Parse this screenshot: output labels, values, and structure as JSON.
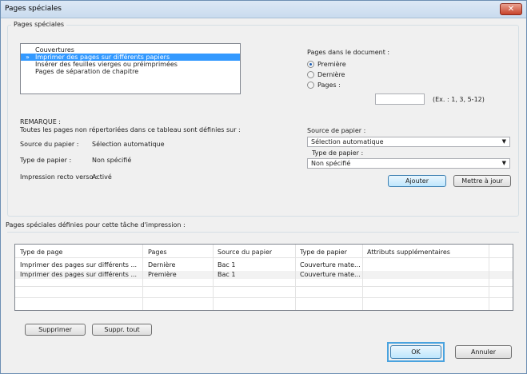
{
  "window": {
    "title": "Pages spéciales",
    "close_glyph": "✕"
  },
  "group_title": "Pages spéciales",
  "types_list": {
    "items": [
      {
        "label": "Couvertures"
      },
      {
        "label": "Imprimer des pages sur différents papiers",
        "selected": true
      },
      {
        "label": "Insérer des feuilles vierges ou préimprimées"
      },
      {
        "label": "Pages de séparation de chapitre"
      }
    ],
    "selected_marker": "»"
  },
  "pages_in_document": {
    "label": "Pages dans le document :",
    "options": [
      "Première",
      "Dernière",
      "Pages :"
    ],
    "selected": "Première",
    "pages_hint": "(Ex. : 1, 3, 5-12)"
  },
  "remark": {
    "title": "REMARQUE :",
    "text": "Toutes les pages non répertoriées dans ce tableau sont définies sur :",
    "source_label": "Source du papier :",
    "source_value": "Sélection automatique",
    "type_label": "Type de papier :",
    "type_value": "Non spécifié",
    "duplex_label": "Impression recto verso :",
    "duplex_value": "Activé"
  },
  "right_panel": {
    "source_label": "Source de papier :",
    "source_value": "Sélection automatique",
    "type_label": "Type de papier :",
    "type_value": "Non spécifié",
    "add_button": "Ajouter",
    "update_button": "Mettre à jour",
    "dropdown_glyph": "▼"
  },
  "table_section_label": "Pages spéciales définies pour cette tâche d'impression :",
  "table": {
    "headers": [
      "Type de page",
      "Pages",
      "Source du papier",
      "Type de papier",
      "Attributs supplémentaires"
    ],
    "rows": [
      [
        "Imprimer des pages sur différents ...",
        "Dernière",
        "Bac 1",
        "Couverture mate...",
        ""
      ],
      [
        "Imprimer des pages sur différents ...",
        "Première",
        "Bac 1",
        "Couverture mate...",
        ""
      ]
    ]
  },
  "buttons": {
    "delete": "Supprimer",
    "delete_all": "Suppr. tout",
    "ok": "OK",
    "cancel": "Annuler"
  }
}
